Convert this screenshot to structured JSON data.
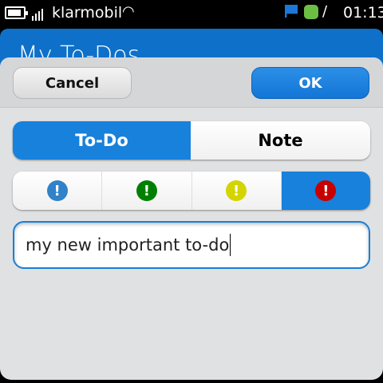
{
  "status_bar": {
    "carrier": "klarmobil",
    "time": "01:13",
    "icons": [
      "battery-icon",
      "signal-icon",
      "wifi-icon",
      "flag-icon",
      "green-status-icon",
      "muted-icon"
    ]
  },
  "app": {
    "title": "My To-Dos"
  },
  "dialog": {
    "cancel_label": "Cancel",
    "ok_label": "OK",
    "type_options": [
      {
        "label": "To-Do",
        "selected": true
      },
      {
        "label": "Note",
        "selected": false
      }
    ],
    "priorities": [
      {
        "name": "low",
        "color": "#3182c8",
        "glyph": "!",
        "selected": false
      },
      {
        "name": "normal",
        "color": "#008000",
        "glyph": "!",
        "selected": false
      },
      {
        "name": "medium",
        "color": "#d4d400",
        "glyph": "!",
        "selected": false
      },
      {
        "name": "high",
        "color": "#c80000",
        "glyph": "!",
        "selected": true
      }
    ],
    "input_value": "my new important to-do"
  },
  "colors": {
    "accent": "#1781dc",
    "header": "#0e70c9"
  }
}
